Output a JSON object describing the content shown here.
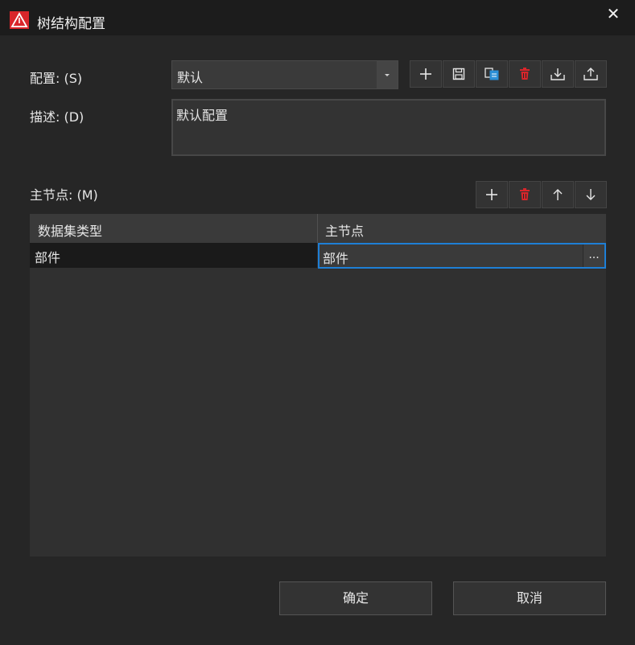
{
  "window": {
    "title": "树结构配置",
    "close_label": "✕"
  },
  "config": {
    "label": "配置: (S)",
    "selected": "默认",
    "toolbar": [
      "add-icon",
      "save-icon",
      "copy-icon",
      "delete-icon",
      "import-icon",
      "export-icon"
    ]
  },
  "description": {
    "label": "描述: (D)",
    "value": "默认配置"
  },
  "main_node": {
    "label": "主节点: (M)",
    "toolbar": [
      "add-icon",
      "delete-icon",
      "arrow-up-icon",
      "arrow-down-icon"
    ],
    "columns": [
      "数据集类型",
      "主节点"
    ],
    "rows": [
      {
        "type": "部件",
        "node": "部件",
        "browse": "..."
      }
    ]
  },
  "buttons": {
    "ok": "确定",
    "cancel": "取消"
  },
  "colors": {
    "accent": "#1e7fd6",
    "delete": "#d9262b",
    "copy": "#2b8fd6"
  }
}
